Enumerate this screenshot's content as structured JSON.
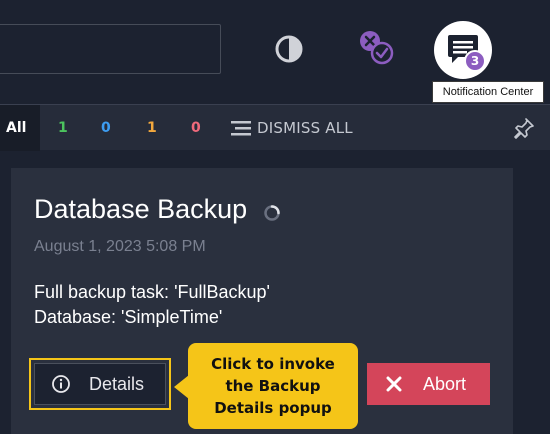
{
  "colors": {
    "background": "#1c2230",
    "card": "#2a303e",
    "success": "#4cc45e",
    "info": "#3d9df2",
    "warning": "#f2a83d",
    "error": "#f06a7c",
    "accent_purple": "#8c5dc0",
    "callout": "#f5c518",
    "abort": "#d4455a"
  },
  "header": {
    "icons": [
      "theme-toggle-icon",
      "tasks-icon",
      "notification-center-icon"
    ],
    "notification_count": "3",
    "tooltip": "Notification Center"
  },
  "filters": {
    "all_label": "All",
    "counts": [
      {
        "value": "1",
        "color": "#4cc45e"
      },
      {
        "value": "0",
        "color": "#3d9df2"
      },
      {
        "value": "1",
        "color": "#f2a83d"
      },
      {
        "value": "0",
        "color": "#f06a7c"
      }
    ],
    "dismiss_all_label": "DISMISS ALL"
  },
  "notification": {
    "title": "Database Backup",
    "timestamp": "August 1, 2023 5:08 PM",
    "body_line1": "Full backup task: 'FullBackup'",
    "body_line2": "Database: 'SimpleTime'",
    "details_label": "Details",
    "abort_label": "Abort"
  },
  "callout": {
    "line1": "Click to invoke",
    "line2": "the Backup",
    "line3": "Details popup"
  }
}
